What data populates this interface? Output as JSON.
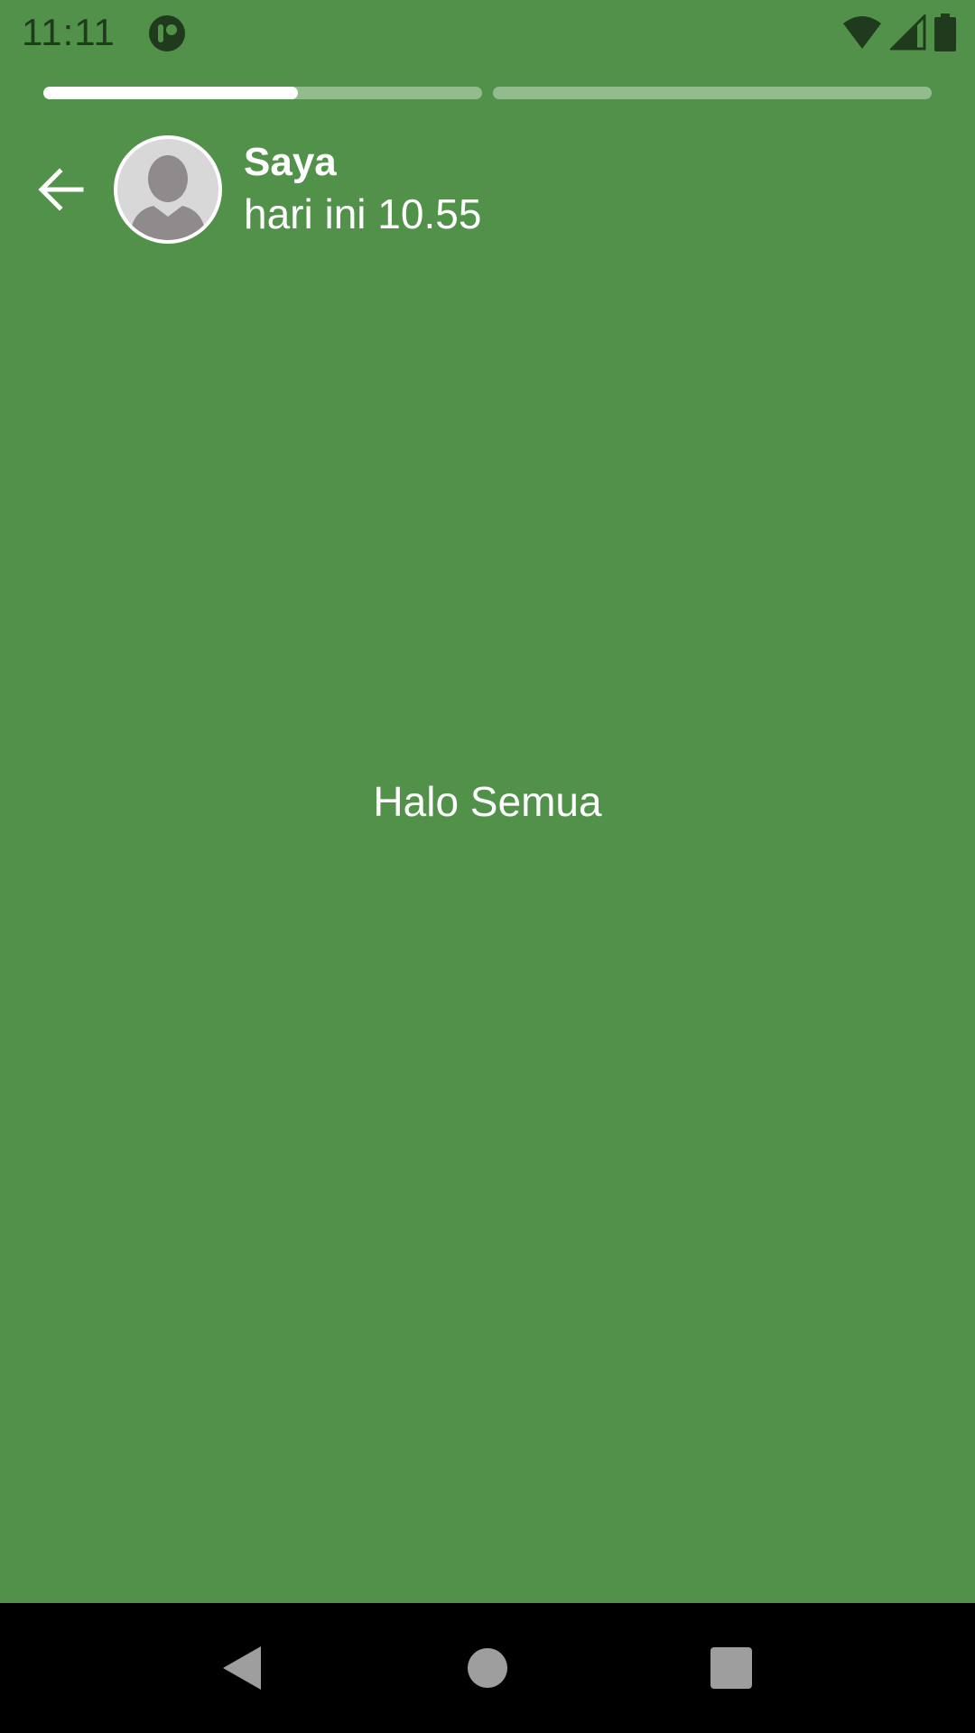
{
  "status_bar": {
    "time": "11:11",
    "app_icon": "notification-app-icon",
    "icons": [
      "wifi-icon",
      "signal-icon",
      "battery-icon"
    ]
  },
  "story": {
    "segment_progress": [
      0.58,
      0
    ],
    "author": "Saya",
    "timestamp": "hari ini 10.55",
    "text": "Halo Semua",
    "background_color": "#52914a"
  },
  "nav_bar": {
    "buttons": [
      "back-triangle-icon",
      "home-circle-icon",
      "recents-square-icon"
    ]
  }
}
